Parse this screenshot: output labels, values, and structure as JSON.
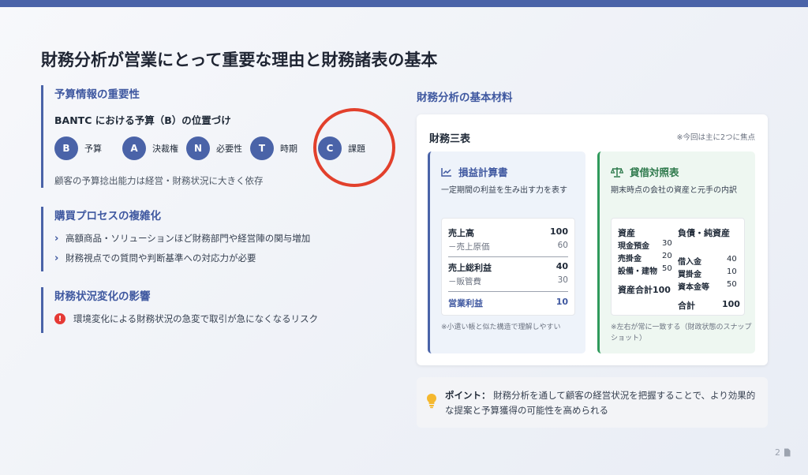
{
  "slide": {
    "title": "財務分析が営業にとって重要な理由と財務諸表の基本",
    "page_number": "2"
  },
  "budget": {
    "heading": "予算情報の重要性",
    "subtitle": "BANTC における予算（B）の位置づけ",
    "items": [
      {
        "letter": "B",
        "label": "予算"
      },
      {
        "letter": "A",
        "label": "決裁権"
      },
      {
        "letter": "N",
        "label": "必要性"
      },
      {
        "letter": "T",
        "label": "時期"
      },
      {
        "letter": "C",
        "label": "課題"
      }
    ],
    "note": "顧客の予算捻出能力は経営・財務状況に大きく依存"
  },
  "purchase": {
    "heading": "購買プロセスの複雑化",
    "bullets": [
      "高額商品・ソリューションほど財務部門や経営陣の関与増加",
      "財務視点での質問や判断基準への対応力が必要"
    ]
  },
  "finance_change": {
    "heading": "財務状況変化の影響",
    "risk": "環境変化による財務状況の急変で取引が急になくなるリスク"
  },
  "materials": {
    "heading": "財務分析の基本材料",
    "card_title": "財務三表",
    "card_note": "※今回は主に2つに焦点",
    "pl": {
      "title": "損益計算書",
      "desc": "一定期間の利益を生み出す力を表す",
      "rows": [
        {
          "label": "売上高",
          "value": "100"
        },
        {
          "label": "－売上原価",
          "value": "60"
        },
        {
          "label": "売上総利益",
          "value": "40"
        },
        {
          "label": "－販管費",
          "value": "30"
        },
        {
          "label": "営業利益",
          "value": "10"
        }
      ],
      "foot": "※小遣い帳と似た構造で理解しやすい"
    },
    "bs": {
      "title": "貸借対照表",
      "desc": "期末時点の会社の資産と元手の内訳",
      "assets_head": "資産",
      "liab_head": "負債・純資産",
      "assets": [
        {
          "label": "現金預金",
          "value": "30"
        },
        {
          "label": "売掛金",
          "value": "20"
        },
        {
          "label": "設備・建物",
          "value": "50"
        }
      ],
      "liabs": [
        {
          "label": "借入金",
          "value": "40"
        },
        {
          "label": "買掛金",
          "value": "10"
        },
        {
          "label": "資本金等",
          "value": "50"
        }
      ],
      "assets_total": "資産合計100",
      "liab_total_label": "合計",
      "liab_total_value": "100",
      "foot": "※左右が常に一致する（財政状態のスナップショット）"
    }
  },
  "point": {
    "label": "ポイント：",
    "text": "財務分析を通して顧客の経営状況を把握することで、より効果的な提案と予算獲得の可能性を高められる"
  },
  "colors": {
    "accent": "#4a63a8",
    "green": "#2f9a5b",
    "annotation_red": "#e2402c"
  }
}
